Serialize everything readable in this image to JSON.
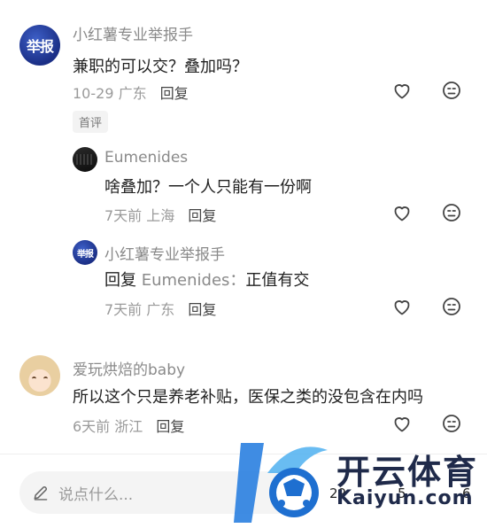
{
  "comments": [
    {
      "avatar_text": "举报",
      "username": "小红薯专业举报手",
      "text": "兼职的可以交？叠加吗？",
      "time": "10-29",
      "location": "广东",
      "reply_label": "回复",
      "badge": "首评"
    },
    {
      "username": "Eumenides",
      "text": "啥叠加？一个人只能有一份啊",
      "time": "7天前",
      "location": "上海",
      "reply_label": "回复"
    },
    {
      "avatar_text": "举报",
      "username": "小红薯专业举报手",
      "reply_prefix": "回复",
      "reply_target": "Eumenides",
      "text": "正值有交",
      "time": "7天前",
      "location": "广东",
      "reply_label": "回复"
    },
    {
      "username": "爱玩烘焙的baby",
      "text": "所以这个只是养老补贴，医保之类的没包含在内吗",
      "time": "6天前",
      "location": "浙江",
      "reply_label": "回复"
    }
  ],
  "bottom_bar": {
    "input_placeholder": "说点什么...",
    "like_count": "29",
    "collect_count": "5",
    "comment_count": "6"
  },
  "watermark": {
    "brand": "开云体育",
    "url": "Kaiyun.com",
    "colors": {
      "primary": "#1f2a4a",
      "accent": "#2a7fe0"
    }
  },
  "icons": [
    "heart-icon",
    "dislike-face-icon",
    "pen-icon"
  ]
}
